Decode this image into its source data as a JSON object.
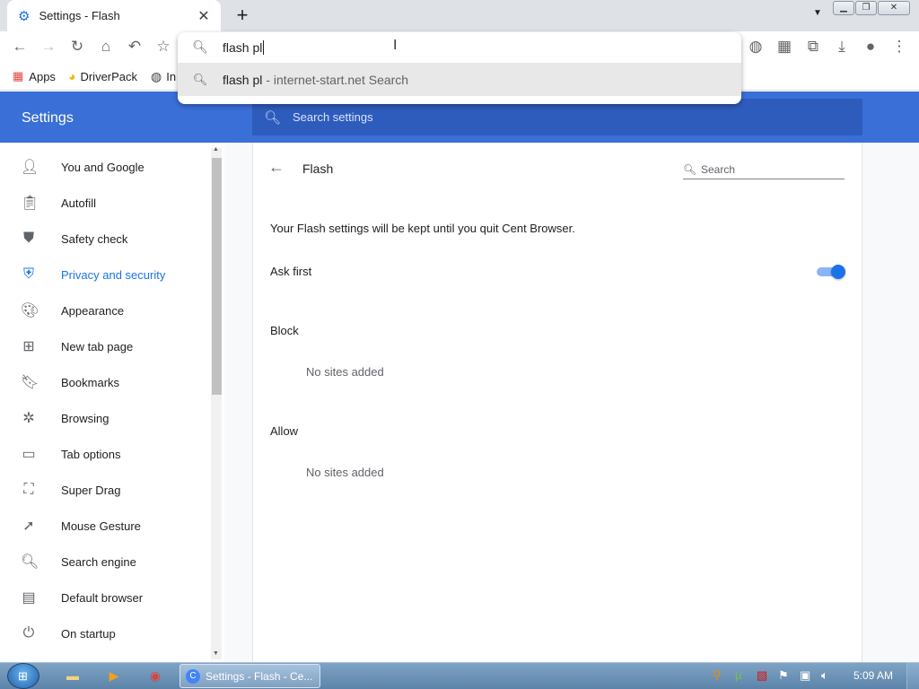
{
  "browser": {
    "tab_title": "Settings - Flash",
    "tab_close": "✕",
    "new_tab": "+"
  },
  "bookmarks": [
    {
      "label": "Apps"
    },
    {
      "label": "DriverPack"
    },
    {
      "label": "In"
    }
  ],
  "omnibox": {
    "input_value": "flash pl",
    "suggestion_query": "flash pl",
    "suggestion_source": "- internet-start.net Search"
  },
  "settings_header": {
    "title": "Settings",
    "search_placeholder": "Search settings"
  },
  "sidebar": {
    "items": [
      {
        "label": "You and Google",
        "icon": "person-icon"
      },
      {
        "label": "Autofill",
        "icon": "clipboard-icon"
      },
      {
        "label": "Safety check",
        "icon": "shield-check-icon"
      },
      {
        "label": "Privacy and security",
        "icon": "shield-icon",
        "active": true
      },
      {
        "label": "Appearance",
        "icon": "palette-icon"
      },
      {
        "label": "New tab page",
        "icon": "new-tab-icon"
      },
      {
        "label": "Bookmarks",
        "icon": "bookmark-icon"
      },
      {
        "label": "Browsing",
        "icon": "browsing-icon"
      },
      {
        "label": "Tab options",
        "icon": "tab-icon"
      },
      {
        "label": "Super Drag",
        "icon": "drag-icon"
      },
      {
        "label": "Mouse Gesture",
        "icon": "cursor-icon"
      },
      {
        "label": "Search engine",
        "icon": "search-icon"
      },
      {
        "label": "Default browser",
        "icon": "browser-icon"
      },
      {
        "label": "On startup",
        "icon": "power-icon"
      }
    ]
  },
  "page": {
    "title": "Flash",
    "search_placeholder": "Search",
    "description": "Your Flash settings will be kept until you quit Cent Browser.",
    "ask_first_label": "Ask first",
    "ask_first_enabled": true,
    "block_header": "Block",
    "block_empty": "No sites added",
    "allow_header": "Allow",
    "allow_empty": "No sites added"
  },
  "taskbar": {
    "active_window": "Settings - Flash - Ce...",
    "clock": "5:09 AM"
  },
  "colors": {
    "accent": "#1a73e8",
    "header_blue": "#3a6fd8"
  }
}
